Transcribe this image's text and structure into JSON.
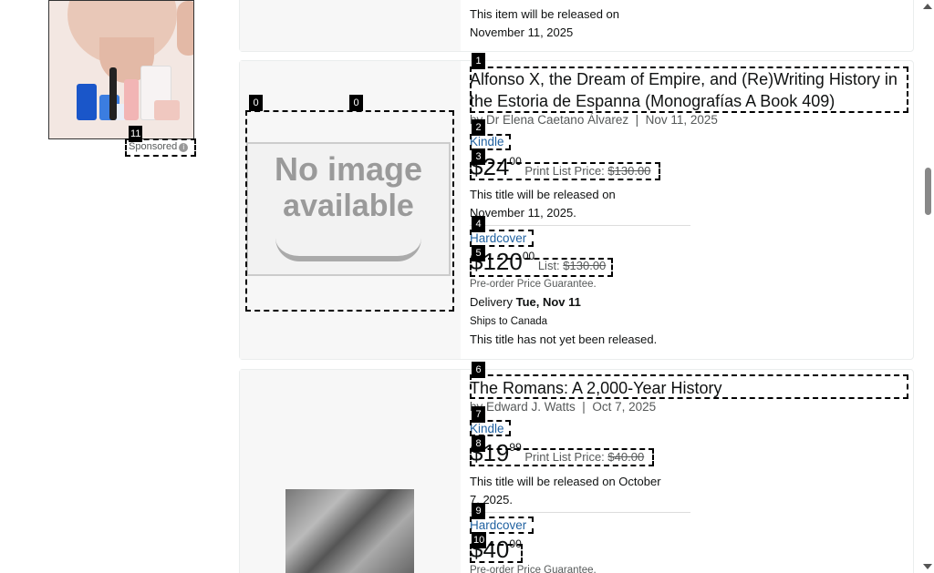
{
  "ad": {
    "sponsored_label": "Sponsored",
    "info_icon": "i"
  },
  "top_item": {
    "release_line1": "This item will be released on",
    "release_line2": "November 11, 2025"
  },
  "product1": {
    "title_line1": "Alfonso X, the Dream of Empire, and (Re)Writing History in",
    "title_line2": "the Estoria de Espanna (Monografías A Book 409)",
    "author": "by Dr Elena Caetano Álvarez",
    "date": "Nov 11, 2025",
    "kindle": {
      "label": "Kindle",
      "price_whole": "$24",
      "price_frac": "00",
      "list_label": "Print List Price:",
      "list_price": "$130.00",
      "release_line1": "This title will be released on",
      "release_line2": "November 11, 2025."
    },
    "hardcover": {
      "label": "Hardcover",
      "price_whole": "$120",
      "price_frac": "00",
      "list_label": "List:",
      "list_price": "$130.00",
      "guarantee": "Pre-order Price Guarantee.",
      "delivery_label": "Delivery",
      "delivery_date": "Tue, Nov 11",
      "ships": "Ships to Canada",
      "not_released": "This title has not yet been released."
    },
    "noimage_line1": "No image",
    "noimage_line2": "available"
  },
  "product2": {
    "title": "The Romans: A 2,000-Year History",
    "author": "by Edward J. Watts",
    "date": "Oct 7, 2025",
    "kindle": {
      "label": "Kindle",
      "price_whole": "$19",
      "price_frac": "99",
      "list_label": "Print List Price:",
      "list_price": "$40.00",
      "release_line1": "This title will be released on October",
      "release_line2": "7, 2025."
    },
    "hardcover": {
      "label": "Hardcover",
      "price_whole": "$40",
      "price_frac": "00",
      "guarantee": "Pre-order Price Guarantee."
    }
  },
  "tags": {
    "t0a": "0",
    "t0b": "0",
    "t1": "1",
    "t2": "2",
    "t3": "3",
    "t4": "4",
    "t5": "5",
    "t6": "6",
    "t7": "7",
    "t8": "8",
    "t9": "9",
    "t10": "10",
    "t11": "11"
  }
}
